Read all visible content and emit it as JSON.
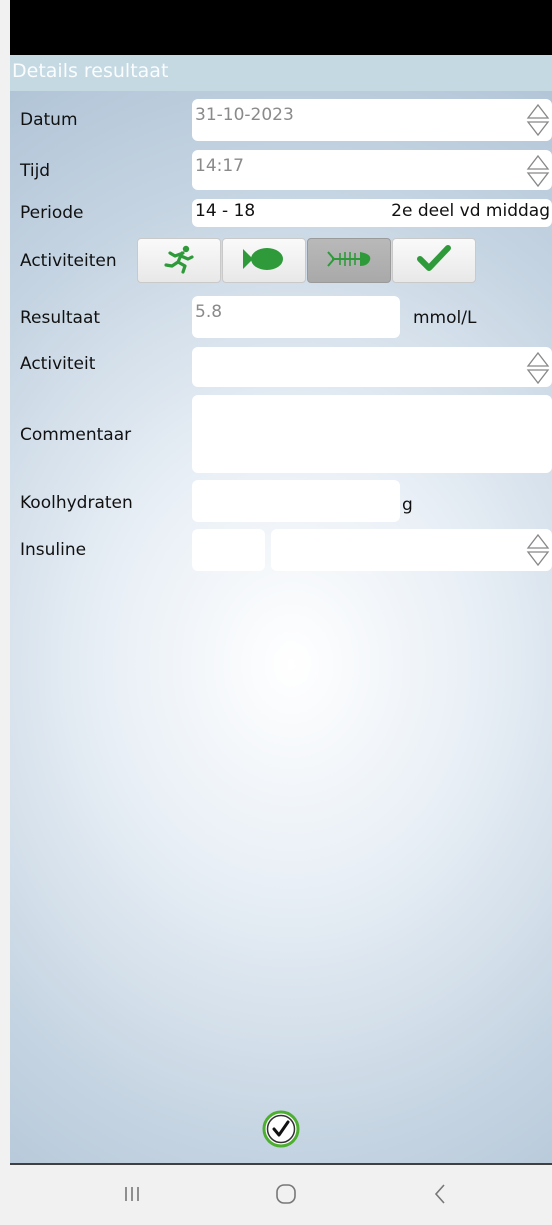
{
  "window": {
    "title": "Details resultaat"
  },
  "fields": {
    "datum": {
      "label": "Datum",
      "value": "31-10-2023"
    },
    "tijd": {
      "label": "Tijd",
      "value": "14:17"
    },
    "periode": {
      "label": "Periode",
      "range": "14 - 18",
      "description": "2e deel vd middag"
    },
    "activiteiten": {
      "label": "Activiteiten",
      "buttons": [
        {
          "icon": "running-icon",
          "selected": false
        },
        {
          "icon": "fish-icon",
          "selected": false
        },
        {
          "icon": "fish-bone-icon",
          "selected": true
        },
        {
          "icon": "checkmark-icon",
          "selected": false
        }
      ]
    },
    "resultaat": {
      "label": "Resultaat",
      "value": "5.8",
      "unit": "mmol/L"
    },
    "activiteit": {
      "label": "Activiteit",
      "value": ""
    },
    "commentaar": {
      "label": "Commentaar",
      "value": ""
    },
    "koolhydraten": {
      "label": "Koolhydraten",
      "value": "",
      "unit": "g"
    },
    "insuline": {
      "label": "Insuline",
      "amount": "",
      "type": ""
    }
  },
  "actions": {
    "confirm_icon": "check-circle-icon"
  },
  "navbar": {
    "items": [
      "recent-apps-icon",
      "home-icon",
      "back-icon"
    ]
  },
  "colors": {
    "accent_green": "#2e9a3a",
    "titlebar": "#c5d9e3",
    "selected_button": "#b3b3b3"
  }
}
